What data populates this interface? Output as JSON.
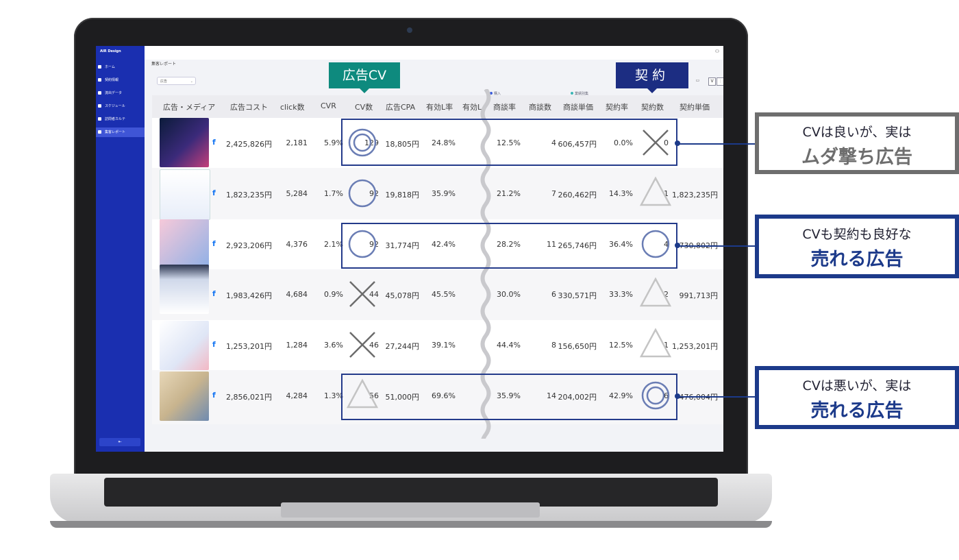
{
  "app": {
    "brand": "AIR Design",
    "page_title": "集客レポート",
    "filter_value": "広告",
    "toolbar_btn": "V"
  },
  "sidebar": {
    "items": [
      {
        "label": "ホーム",
        "icon": "home-icon"
      },
      {
        "label": "契約情報",
        "icon": "contract-icon"
      },
      {
        "label": "流出データ",
        "icon": "data-icon"
      },
      {
        "label": "スケジュール",
        "icon": "calendar-icon"
      },
      {
        "label": "訪問者カルテ",
        "icon": "visitor-icon"
      },
      {
        "label": "集客レポート",
        "icon": "report-icon",
        "active": true
      }
    ],
    "collapse_label": "⇤"
  },
  "legend": {
    "left": "購入",
    "right": "業績別集",
    "left_color": "#3b5bdb",
    "right_color": "#3bb5b5"
  },
  "table": {
    "headers": [
      "広告・メディア",
      "広告コスト",
      "click数",
      "CVR",
      "CV数",
      "広告CPA",
      "有効L率",
      "有効L",
      "商談率",
      "商談数",
      "商談単価",
      "契約率",
      "契約数",
      "契約単価"
    ],
    "rows": [
      {
        "cost": "2,425,826円",
        "clicks": "2,181",
        "cvr": "5.9%",
        "cv": "129",
        "cpa": "18,805円",
        "lrate": "24.8%",
        "mrate": "12.5%",
        "meetings": "4",
        "munit": "606,457円",
        "crate": "0.0%",
        "contracts": "0",
        "cunit": "",
        "cv_mark": "double-circle",
        "ct_mark": "cross"
      },
      {
        "cost": "1,823,235円",
        "clicks": "5,284",
        "cvr": "1.7%",
        "cv": "92",
        "cpa": "19,818円",
        "lrate": "35.9%",
        "mrate": "21.2%",
        "meetings": "7",
        "munit": "260,462円",
        "crate": "14.3%",
        "contracts": "1",
        "cunit": "1,823,235円",
        "cv_mark": "circle",
        "ct_mark": "triangle"
      },
      {
        "cost": "2,923,206円",
        "clicks": "4,376",
        "cvr": "2.1%",
        "cv": "92",
        "cpa": "31,774円",
        "lrate": "42.4%",
        "mrate": "28.2%",
        "meetings": "11",
        "munit": "265,746円",
        "crate": "36.4%",
        "contracts": "4",
        "cunit": "730,802円",
        "cv_mark": "circle",
        "ct_mark": "circle"
      },
      {
        "cost": "1,983,426円",
        "clicks": "4,684",
        "cvr": "0.9%",
        "cv": "44",
        "cpa": "45,078円",
        "lrate": "45.5%",
        "mrate": "30.0%",
        "meetings": "6",
        "munit": "330,571円",
        "crate": "33.3%",
        "contracts": "2",
        "cunit": "991,713円",
        "cv_mark": "cross",
        "ct_mark": "triangle"
      },
      {
        "cost": "1,253,201円",
        "clicks": "1,284",
        "cvr": "3.6%",
        "cv": "46",
        "cpa": "27,244円",
        "lrate": "39.1%",
        "mrate": "44.4%",
        "meetings": "8",
        "munit": "156,650円",
        "crate": "12.5%",
        "contracts": "1",
        "cunit": "1,253,201円",
        "cv_mark": "cross",
        "ct_mark": "triangle"
      },
      {
        "cost": "2,856,021円",
        "clicks": "4,284",
        "cvr": "1.3%",
        "cv": "56",
        "cpa": "51,000円",
        "lrate": "69.6%",
        "mrate": "35.9%",
        "meetings": "14",
        "munit": "204,002円",
        "crate": "42.9%",
        "contracts": "6",
        "cunit": "476,004円",
        "cv_mark": "triangle",
        "ct_mark": "double-circle"
      }
    ]
  },
  "tags": {
    "cv": "広告CV",
    "cv_color": "#0e8a7e",
    "contract": "契約",
    "contract_color": "#1c2d82"
  },
  "callouts": [
    {
      "line1": "CVは良いが、実は",
      "line2": "ムダ撃ち広告",
      "color": "#6e6e6e"
    },
    {
      "line1": "CVも契約も良好な",
      "line2": "売れる広告",
      "color": "#1c3a8a"
    },
    {
      "line1": "CVは悪いが、実は",
      "line2": "売れる広告",
      "color": "#1c3a8a"
    }
  ]
}
